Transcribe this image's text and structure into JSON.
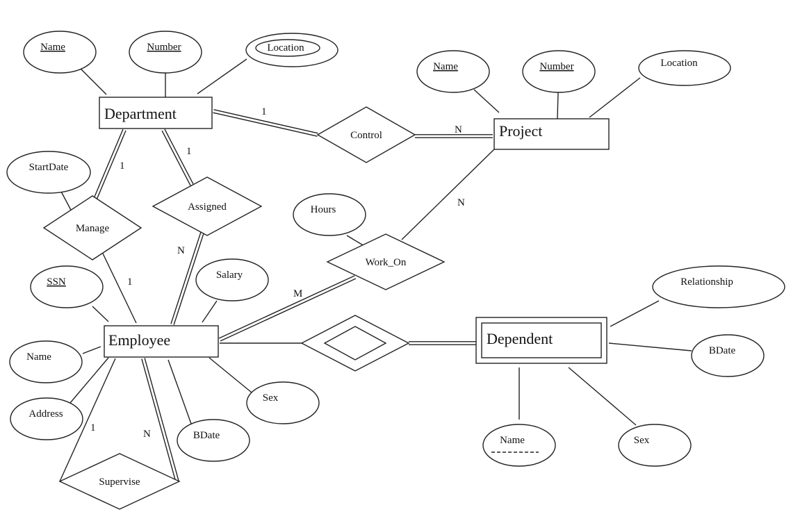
{
  "diagram": {
    "type": "er-diagram",
    "entities": [
      {
        "id": "department",
        "label": "Department",
        "weak": false
      },
      {
        "id": "project",
        "label": "Project",
        "weak": false
      },
      {
        "id": "employee",
        "label": "Employee",
        "weak": false
      },
      {
        "id": "dependent",
        "label": "Dependent",
        "weak": true
      }
    ],
    "relationships": [
      {
        "id": "control",
        "label": "Control",
        "identifying": false
      },
      {
        "id": "manage",
        "label": "Manage",
        "identifying": false
      },
      {
        "id": "assigned",
        "label": "Assigned",
        "identifying": false
      },
      {
        "id": "work_on",
        "label": "Work_On",
        "identifying": false
      },
      {
        "id": "supervise",
        "label": "Supervise",
        "identifying": false
      },
      {
        "id": "dependents_of",
        "label": "",
        "identifying": true
      }
    ],
    "attributes": [
      {
        "id": "dept_name",
        "label": "Name",
        "owner": "department",
        "key": true,
        "partial_key": false,
        "multivalued": false
      },
      {
        "id": "dept_number",
        "label": "Number",
        "owner": "department",
        "key": true,
        "partial_key": false,
        "multivalued": false
      },
      {
        "id": "dept_location",
        "label": "Location",
        "owner": "department",
        "key": false,
        "partial_key": false,
        "multivalued": true
      },
      {
        "id": "proj_name",
        "label": "Name",
        "owner": "project",
        "key": true,
        "partial_key": false,
        "multivalued": false
      },
      {
        "id": "proj_number",
        "label": "Number",
        "owner": "project",
        "key": true,
        "partial_key": false,
        "multivalued": false
      },
      {
        "id": "proj_location",
        "label": "Location",
        "owner": "project",
        "key": false,
        "partial_key": false,
        "multivalued": false
      },
      {
        "id": "startdate",
        "label": "StartDate",
        "owner": "manage",
        "key": false,
        "partial_key": false,
        "multivalued": false
      },
      {
        "id": "hours",
        "label": "Hours",
        "owner": "work_on",
        "key": false,
        "partial_key": false,
        "multivalued": false
      },
      {
        "id": "emp_ssn",
        "label": "SSN",
        "owner": "employee",
        "key": true,
        "partial_key": false,
        "multivalued": false
      },
      {
        "id": "emp_salary",
        "label": "Salary",
        "owner": "employee",
        "key": false,
        "partial_key": false,
        "multivalued": false
      },
      {
        "id": "emp_name",
        "label": "Name",
        "owner": "employee",
        "key": false,
        "partial_key": false,
        "multivalued": false
      },
      {
        "id": "emp_address",
        "label": "Address",
        "owner": "employee",
        "key": false,
        "partial_key": false,
        "multivalued": false
      },
      {
        "id": "emp_sex",
        "label": "Sex",
        "owner": "employee",
        "key": false,
        "partial_key": false,
        "multivalued": false
      },
      {
        "id": "emp_bdate",
        "label": "BDate",
        "owner": "employee",
        "key": false,
        "partial_key": false,
        "multivalued": false
      },
      {
        "id": "dep_relationship",
        "label": "Relationship",
        "owner": "dependent",
        "key": false,
        "partial_key": false,
        "multivalued": false
      },
      {
        "id": "dep_bdate",
        "label": "BDate",
        "owner": "dependent",
        "key": false,
        "partial_key": false,
        "multivalued": false
      },
      {
        "id": "dep_name",
        "label": "Name",
        "owner": "dependent",
        "key": false,
        "partial_key": true,
        "multivalued": false
      },
      {
        "id": "dep_sex",
        "label": "Sex",
        "owner": "dependent",
        "key": false,
        "partial_key": false,
        "multivalued": false
      }
    ],
    "participations": [
      {
        "id": "dept_control",
        "from": "department",
        "to": "control",
        "cardinality": "1",
        "total": true
      },
      {
        "id": "control_proj",
        "from": "control",
        "to": "project",
        "cardinality": "N",
        "total": true
      },
      {
        "id": "dept_manage",
        "from": "department",
        "to": "manage",
        "cardinality": "1",
        "total": true
      },
      {
        "id": "manage_emp",
        "from": "manage",
        "to": "employee",
        "cardinality": "1",
        "total": false
      },
      {
        "id": "dept_assigned",
        "from": "department",
        "to": "assigned",
        "cardinality": "1",
        "total": true
      },
      {
        "id": "assigned_emp",
        "from": "assigned",
        "to": "employee",
        "cardinality": "N",
        "total": true
      },
      {
        "id": "proj_workon",
        "from": "project",
        "to": "work_on",
        "cardinality": "N",
        "total": false
      },
      {
        "id": "workon_emp",
        "from": "work_on",
        "to": "employee",
        "cardinality": "M",
        "total": true
      },
      {
        "id": "emp_supervise_1",
        "from": "employee",
        "to": "supervise",
        "cardinality": "1",
        "total": false
      },
      {
        "id": "emp_supervise_n",
        "from": "employee",
        "to": "supervise",
        "cardinality": "N",
        "total": true
      },
      {
        "id": "emp_depof",
        "from": "employee",
        "to": "dependents_of",
        "cardinality": "",
        "total": false
      },
      {
        "id": "depof_dep",
        "from": "dependents_of",
        "to": "dependent",
        "cardinality": "",
        "total": true
      }
    ]
  }
}
